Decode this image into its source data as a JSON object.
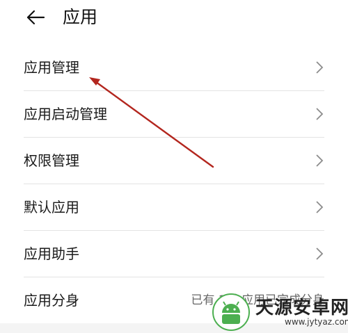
{
  "header": {
    "title": "应用"
  },
  "items": [
    {
      "label": "应用管理"
    },
    {
      "label": "应用启动管理"
    },
    {
      "label": "权限管理"
    },
    {
      "label": "默认应用"
    },
    {
      "label": "应用助手"
    },
    {
      "label": "应用分身",
      "value": "已有 1 个应用已完成分身"
    }
  ],
  "watermark": {
    "title": "天源安卓网",
    "url": "www.jytyaz.com"
  },
  "colors": {
    "annotation_arrow": "#b3261e",
    "logo_green": "#4caf50"
  }
}
